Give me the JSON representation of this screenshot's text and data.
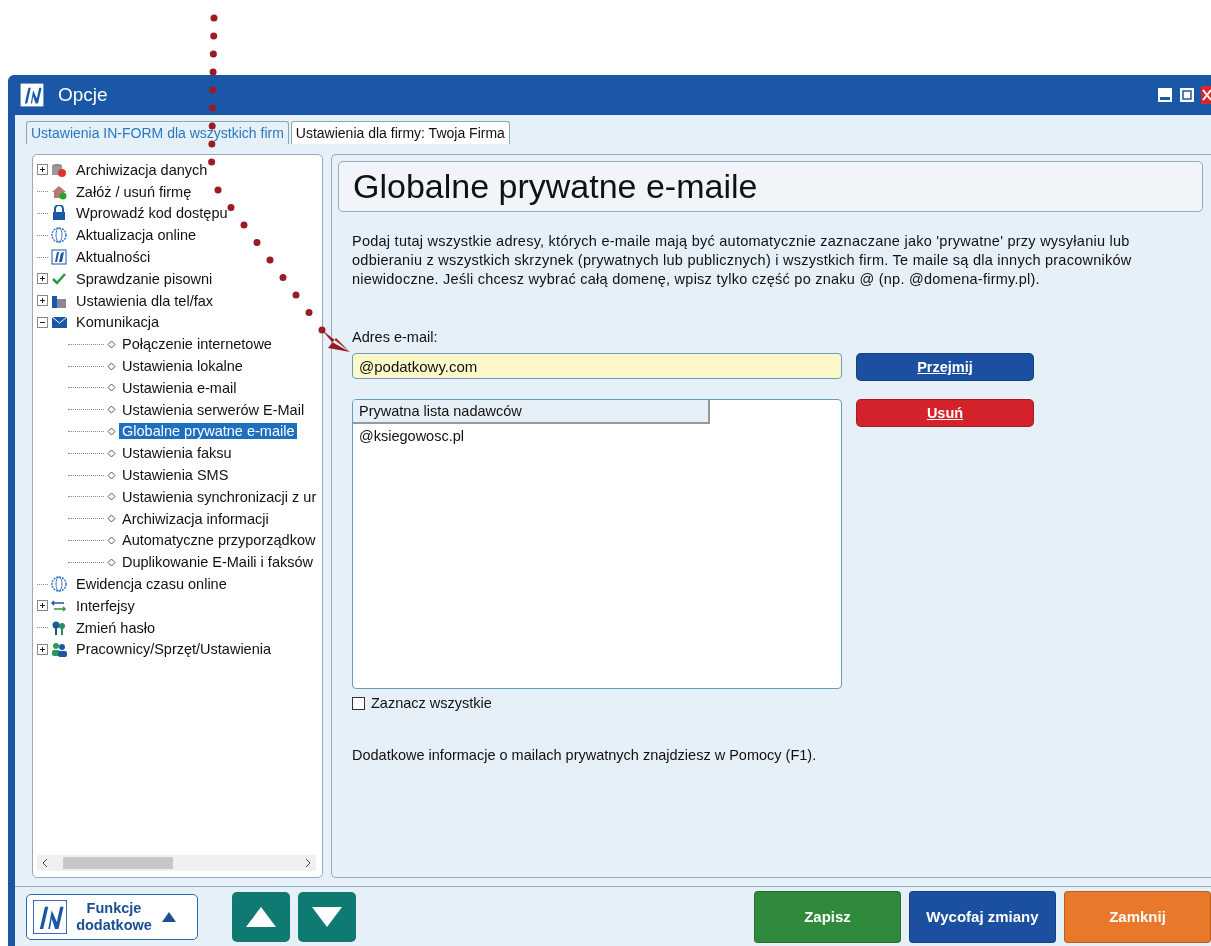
{
  "window": {
    "title": "Opcje"
  },
  "tabs": [
    {
      "label": "Ustawienia IN-FORM dla wszystkich firm",
      "selected": true
    },
    {
      "label": "Ustawienia dla firmy: Twoja Firma",
      "selected": false
    }
  ],
  "tree": [
    {
      "label": "Archiwizacja danych",
      "expanded": false,
      "selected": false
    },
    {
      "label": "Załóż / usuń firmę",
      "selected": false
    },
    {
      "label": "Wprowadź kod dostępu",
      "selected": false
    },
    {
      "label": "Aktualizacja online",
      "selected": false
    },
    {
      "label": "Aktualności",
      "selected": false
    },
    {
      "label": "Sprawdzanie pisowni",
      "expanded": false,
      "selected": false
    },
    {
      "label": "Ustawienia dla tel/fax",
      "expanded": false,
      "selected": false
    },
    {
      "label": "Komunikacja",
      "expanded": true,
      "selected": false,
      "children": [
        {
          "label": "Połączenie internetowe",
          "selected": false
        },
        {
          "label": "Ustawienia lokalne",
          "selected": false
        },
        {
          "label": "Ustawienia e-mail",
          "selected": false
        },
        {
          "label": "Ustawienia serwerów E-Mail",
          "selected": false
        },
        {
          "label": "Globalne prywatne e-maile",
          "selected": true
        },
        {
          "label": "Ustawienia faksu",
          "selected": false
        },
        {
          "label": "Ustawienia SMS",
          "selected": false
        },
        {
          "label": "Ustawienia synchronizacji z ur",
          "selected": false
        },
        {
          "label": "Archiwizacja informacji",
          "selected": false
        },
        {
          "label": "Automatyczne przyporządkow",
          "selected": false
        },
        {
          "label": "Duplikowanie E-Maili i faksów",
          "selected": false
        }
      ]
    },
    {
      "label": "Ewidencja czasu online",
      "selected": false
    },
    {
      "label": "Interfejsy",
      "expanded": false,
      "selected": false
    },
    {
      "label": "Zmień hasło",
      "selected": false
    },
    {
      "label": "Pracownicy/Sprzęt/Ustawienia",
      "expanded": false,
      "selected": false
    }
  ],
  "panel": {
    "heading": "Globalne prywatne e-maile",
    "description": "Podaj tutaj wszystkie adresy, których e-maile mają być automatycznie zaznaczane jako 'prywatne' przy wysyłaniu lub odbieraniu z wszystkich skrzynek (prywatnych lub publicznych) i wszystkich firm. Te maile są dla innych pracowników niewidoczne. Jeśli chcesz wybrać całą domenę, wpisz tylko część po znaku @ (np. @domena-firmy.pl).",
    "email_label": "Adres e-mail:",
    "email_value": "@podatkowy.com",
    "add_button": "Przejmij",
    "list_header": "Prywatna lista nadawców",
    "list_items": [
      "@ksiegowosc.pl"
    ],
    "remove_button": "Usuń",
    "select_all": {
      "label": "Zaznacz wszystkie",
      "checked": false
    },
    "footer_note": "Dodatkowe informacje o mailach prywatnych znajdziesz w Pomocy (F1)."
  },
  "bottom_bar": {
    "more_button": "Funkcje dodatkowe",
    "actions": [
      {
        "label": "Zapisz",
        "color": "#2f8a3c"
      },
      {
        "label": "Wycofaj zmiany",
        "color": "#1b4fa0"
      },
      {
        "label": "Zamknij",
        "color": "#e8782a"
      }
    ]
  }
}
